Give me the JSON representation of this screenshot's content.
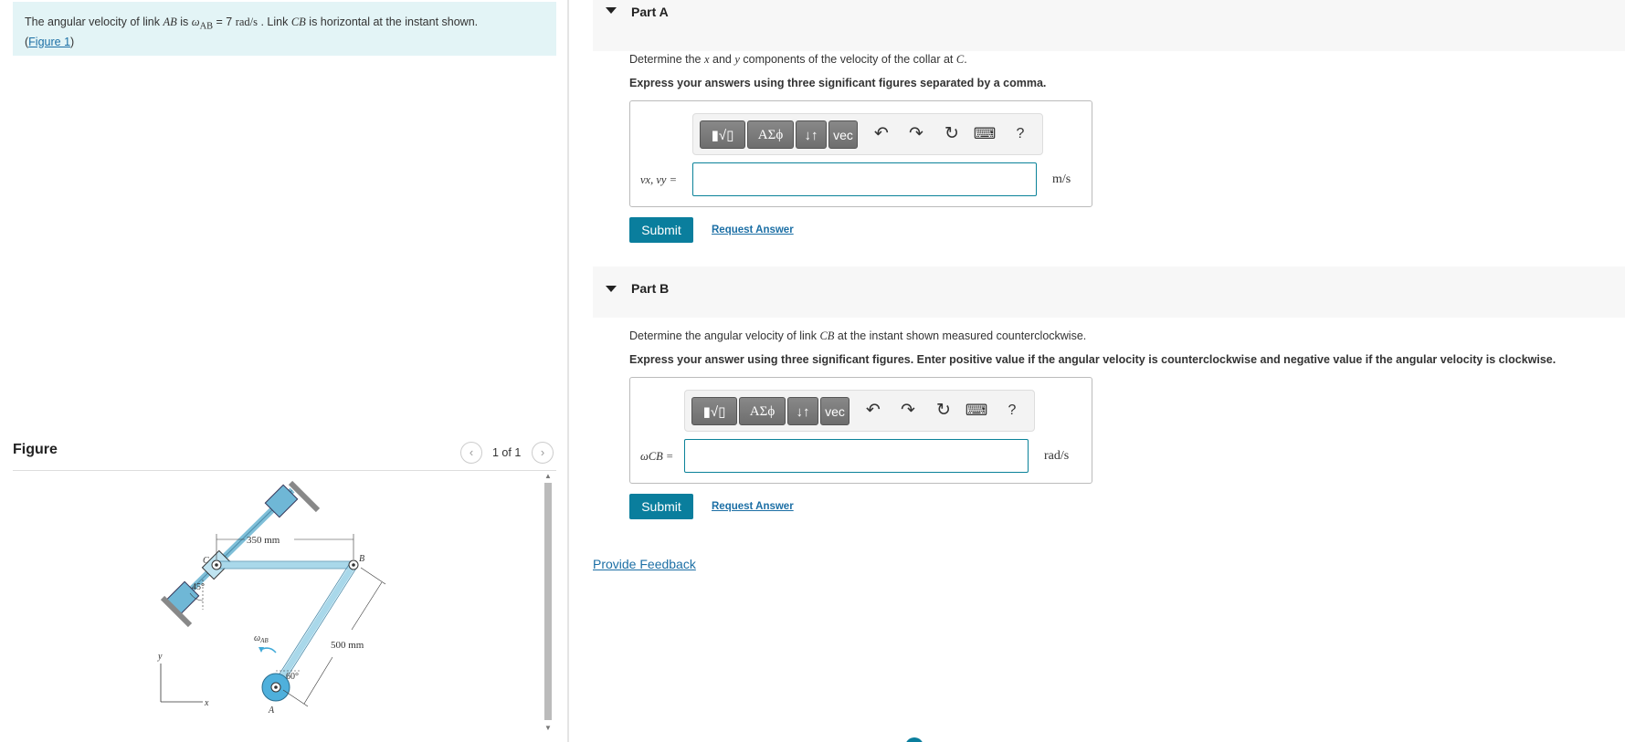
{
  "problem": {
    "text_1": "The angular velocity of link ",
    "link_ab": "AB",
    "text_2": " is ",
    "omega": "ω",
    "omega_sub": "AB",
    "equals_value": " = 7 ",
    "unit": "rad/s",
    "text_3": " . Link ",
    "link_cb": "CB",
    "text_4": " is horizontal at the instant shown.",
    "figure_link_prefix": "(",
    "figure_link": "Figure 1",
    "figure_link_suffix": ")"
  },
  "figure": {
    "title": "Figure",
    "prev_label": "‹",
    "next_label": "›",
    "pager": "1 of 1",
    "labels": {
      "dim_350": "350 mm",
      "dim_500": "500 mm",
      "angle_45": "45°",
      "angle_60": "60°",
      "point_c": "C",
      "point_b": "B",
      "point_a": "A",
      "omega_ab": "ω",
      "omega_ab_sub": "AB",
      "axis_y": "y",
      "axis_x": "x"
    }
  },
  "toolbar": {
    "templates": "▮√▯",
    "greek": "ΑΣϕ",
    "arrows": "↓↑",
    "vec": "vec",
    "undo": "↶",
    "redo": "↷",
    "reset": "↻",
    "keyboard": "⌨",
    "help": "?"
  },
  "part_a": {
    "title": "Part A",
    "question_1": "Determine the ",
    "x": "x",
    "question_2": " and ",
    "y": "y",
    "question_3": " components of the velocity of the collar at ",
    "c": "C",
    "question_4": ".",
    "instruction": "Express your answers using three significant figures separated by a comma.",
    "var_label": "vx, vy =",
    "input_value": "",
    "unit": "m/s",
    "submit": "Submit",
    "request": "Request Answer"
  },
  "part_b": {
    "title": "Part B",
    "question_1": "Determine the angular velocity of link ",
    "cb": "CB",
    "question_2": " at the instant shown measured counterclockwise.",
    "instruction": "Express your answer using three significant figures. Enter positive value if the angular velocity is counterclockwise and negative value if the angular velocity is clockwise.",
    "var_label": "ωCB =",
    "input_value": "",
    "unit": "rad/s",
    "submit": "Submit",
    "request": "Request Answer"
  },
  "feedback": "Provide Feedback",
  "colors": {
    "accent": "#0a7e9d",
    "link": "#1c6fa5",
    "problem_bg": "#e3f4f6",
    "link_blue": "#a9d8ea"
  }
}
